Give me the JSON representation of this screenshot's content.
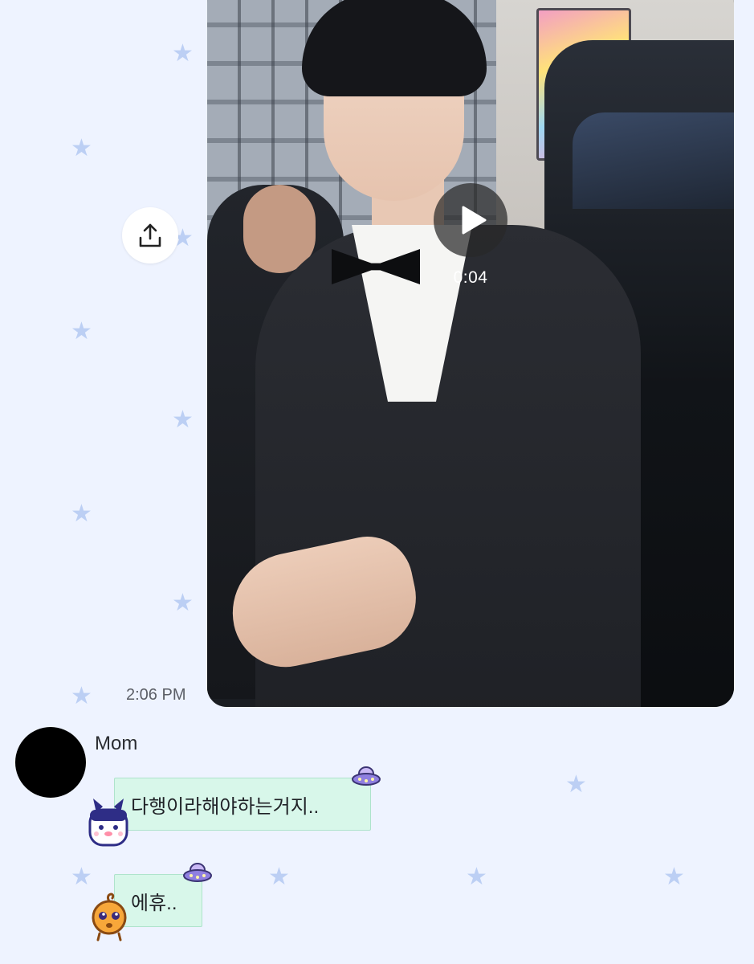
{
  "background": {
    "color": "#eef3ff",
    "pattern_icon": "star-icon",
    "pattern_color": "#bccff4"
  },
  "outgoing": {
    "video": {
      "duration": "0:04",
      "play_icon": "play-icon"
    },
    "share_icon": "share-icon",
    "time": "2:06 PM"
  },
  "incoming": {
    "sender": "Mom",
    "avatar_color": "#000000",
    "messages": [
      {
        "text": "다행이라해야하는거지..",
        "sticker": "bunny-mascot-icon",
        "decoration": "ufo-icon"
      },
      {
        "text": "에휴..",
        "sticker": "orange-mascot-icon",
        "decoration": "ufo-icon"
      }
    ],
    "bubble_color": "#d8f7ea"
  }
}
